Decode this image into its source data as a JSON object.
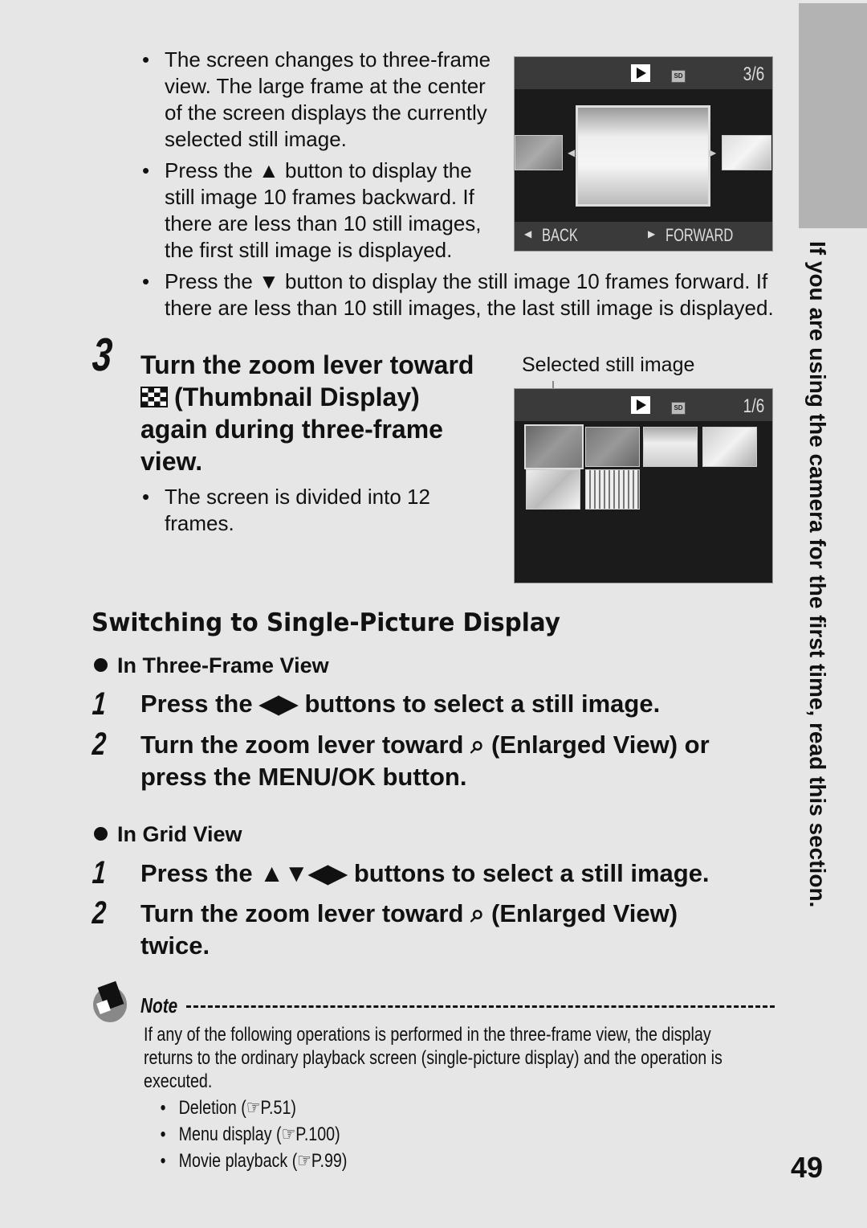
{
  "top_bullets": [
    "The screen changes to three-frame view. The large frame at the center of the screen displays the currently selected still image.",
    "Press the ▲ button to display the still image 10 frames backward. If there are less than 10 still images, the first still image is displayed.",
    "Press the ▼ button to display the still image 10 frames forward. If there are less than 10 still images, the last still image is displayed."
  ],
  "three_frame_screen": {
    "counter": "3/6",
    "back_label": "BACK",
    "forward_label": "FORWARD",
    "sd_label": "SD"
  },
  "step3": {
    "number": "3",
    "title_line1": "Turn the zoom lever toward",
    "title_line2": "(Thumbnail Display)",
    "title_line3": "again during three-frame",
    "title_line4": "view.",
    "bullet": "The screen is divided into 12 frames."
  },
  "grid_screen": {
    "caption": "Selected still image",
    "counter": "1/6",
    "sd_label": "SD"
  },
  "section": {
    "heading": "Switching to Single-Picture Display",
    "three_frame": {
      "subheading": "In Three-Frame View",
      "steps": [
        {
          "num": "1",
          "text": "Press the ◀▶ buttons to select a still image."
        },
        {
          "num": "2",
          "text": "Turn the zoom lever toward ⌕ (Enlarged View) or press the MENU/OK button."
        }
      ]
    },
    "grid": {
      "subheading": "In Grid View",
      "steps": [
        {
          "num": "1",
          "text": "Press the ▲▼◀▶ buttons to select a still image."
        },
        {
          "num": "2",
          "text": "Turn the zoom lever toward ⌕ (Enlarged View) twice."
        }
      ]
    }
  },
  "note": {
    "label": "Note",
    "body": "If any of the following operations is performed in the three-frame view, the display returns to the ordinary playback screen (single-picture display) and the operation is executed.",
    "items": [
      {
        "text": "Deletion (",
        "ref": "P.51",
        "close": ")"
      },
      {
        "text": "Menu display (",
        "ref": "P.100",
        "close": ")"
      },
      {
        "text": "Movie playback (",
        "ref": "P.99",
        "close": ")"
      }
    ]
  },
  "side_tab_text": "If you are using the camera for the first time, read this section.",
  "page_number": "49"
}
